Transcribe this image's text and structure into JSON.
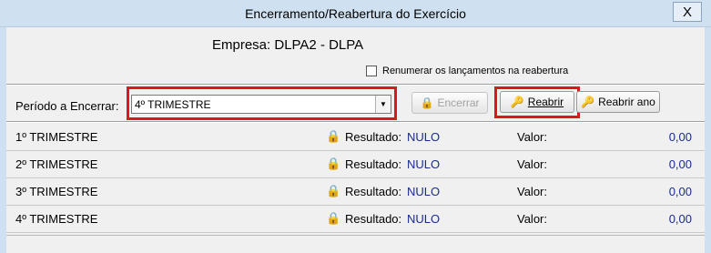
{
  "window": {
    "title": "Encerramento/Reabertura do Exercício",
    "close_label": "X"
  },
  "header": {
    "empresa": "Empresa: DLPA2 - DLPA",
    "renumerar_label": "Renumerar os lançamentos na reabertura",
    "renumerar_checked": false
  },
  "toolbar": {
    "periodo_label": "Período a Encerrar:",
    "periodo_value": "4º TRIMESTRE",
    "encerrar_label": "Encerrar",
    "reabrir_label": "Reabrir",
    "reabrir_ano_label": "Reabrir ano"
  },
  "rows": [
    {
      "name": "1º TRIMESTRE",
      "resultado_label": "Resultado:",
      "resultado": "NULO",
      "valor_label": "Valor:",
      "valor": "0,00"
    },
    {
      "name": "2º TRIMESTRE",
      "resultado_label": "Resultado:",
      "resultado": "NULO",
      "valor_label": "Valor:",
      "valor": "0,00"
    },
    {
      "name": "3º TRIMESTRE",
      "resultado_label": "Resultado:",
      "resultado": "NULO",
      "valor_label": "Valor:",
      "valor": "0,00"
    },
    {
      "name": "4º TRIMESTRE",
      "resultado_label": "Resultado:",
      "resultado": "NULO",
      "valor_label": "Valor:",
      "valor": "0,00"
    }
  ],
  "colors": {
    "highlight": "#d81a1a",
    "value_blue": "#1a2b8c",
    "titlebar": "#cfe0f0"
  },
  "icons": {
    "lock": "lock-icon",
    "key": "key-icon"
  }
}
